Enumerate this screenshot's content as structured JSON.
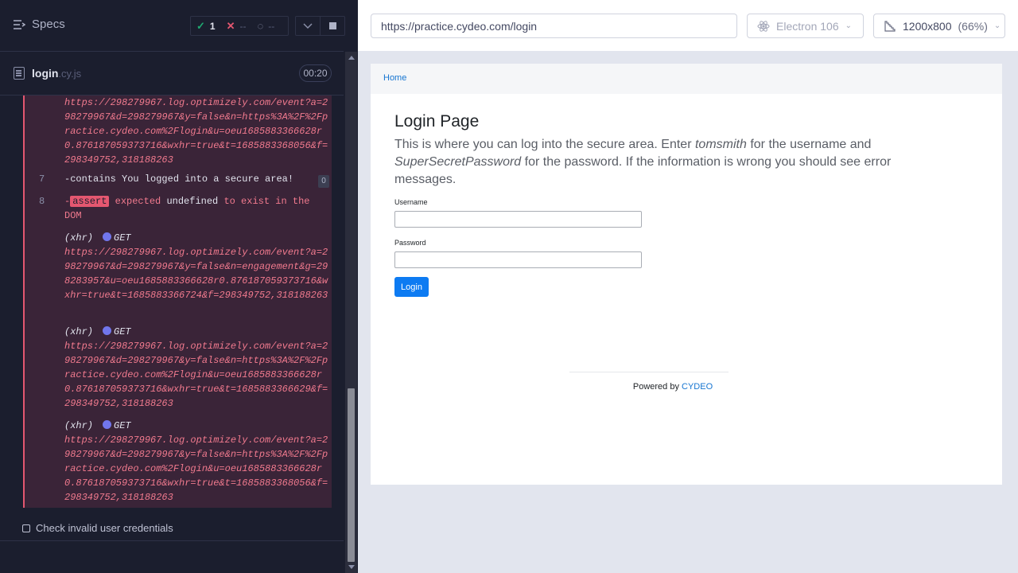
{
  "reporter": {
    "specs_label": "Specs",
    "stats": {
      "passed": "1",
      "failed": "--",
      "pending": "--"
    },
    "file": {
      "name": "login",
      "ext": ".cy.js",
      "duration": "00:20"
    },
    "commands": {
      "prev_url": "https://298279967.log.optimizely.com/event?a=298279967&d=298279967&y=false&n=https%3A%2F%2Fpractice.cydeo.com%2Flogin&u=oeu1685883366628r0.876187059373716&wxhr=true&t=1685883368056&f=298349752,318188263",
      "cmd7": {
        "num": "7",
        "text": "-contains  You logged into a secure area!",
        "badge": "0"
      },
      "cmd8": {
        "num": "8",
        "assert": "assert",
        "expected": "expected",
        "undefined": "undefined",
        "rest1": "to exist in the",
        "rest2": "DOM"
      },
      "xhr1": {
        "tag": "(xhr)",
        "method": "GET",
        "url": "https://298279967.log.optimizely.com/event?a=298279967&d=298279967&y=false&n=engagement&g=298283957&u=oeu1685883366628r0.876187059373716&wxhr=true&t=1685883366724&f=298349752,318188263"
      },
      "xhr2": {
        "tag": "(xhr)",
        "method": "GET",
        "url": "https://298279967.log.optimizely.com/event?a=298279967&d=298279967&y=false&n=https%3A%2F%2Fpractice.cydeo.com%2Flogin&u=oeu1685883366628r0.876187059373716&wxhr=true&t=1685883366629&f=298349752,318188263"
      },
      "xhr3": {
        "tag": "(xhr)",
        "method": "GET",
        "url": "https://298279967.log.optimizely.com/event?a=298279967&d=298279967&y=false&n=https%3A%2F%2Fpractice.cydeo.com%2Flogin&u=oeu1685883366628r0.876187059373716&wxhr=true&t=1685883368056&f=298349752,318188263"
      }
    },
    "test_title": "Check invalid user credentials"
  },
  "aut": {
    "url": "https://practice.cydeo.com/login",
    "browser": "Electron 106",
    "viewport": "1200x800",
    "scale": "(66%)"
  },
  "page": {
    "breadcrumb": "Home",
    "title": "Login Page",
    "desc_1": "This is where you can log into the secure area. Enter ",
    "desc_user": "tomsmith",
    "desc_2": " for the username and ",
    "desc_pass": "SuperSecretPassword",
    "desc_3": " for the password. If the information is wrong you should see error messages.",
    "username_label": "Username",
    "password_label": "Password",
    "login_button": "Login",
    "powered_by": "Powered by ",
    "brand": "CYDEO"
  },
  "colors": {
    "reporter_bg": "#1b1e2e",
    "failed_log_bg": "#3a2438",
    "fail_red": "#e45770",
    "pass_green": "#1fa971",
    "link_blue": "#1675d1",
    "button_blue": "#0d7bf2"
  },
  "icons": [
    "specs-list-icon",
    "check-icon",
    "x-icon",
    "pending-icon",
    "chevron-down-icon",
    "stop-icon",
    "file-icon",
    "electron-icon",
    "viewport-icon",
    "checkbox-icon"
  ]
}
